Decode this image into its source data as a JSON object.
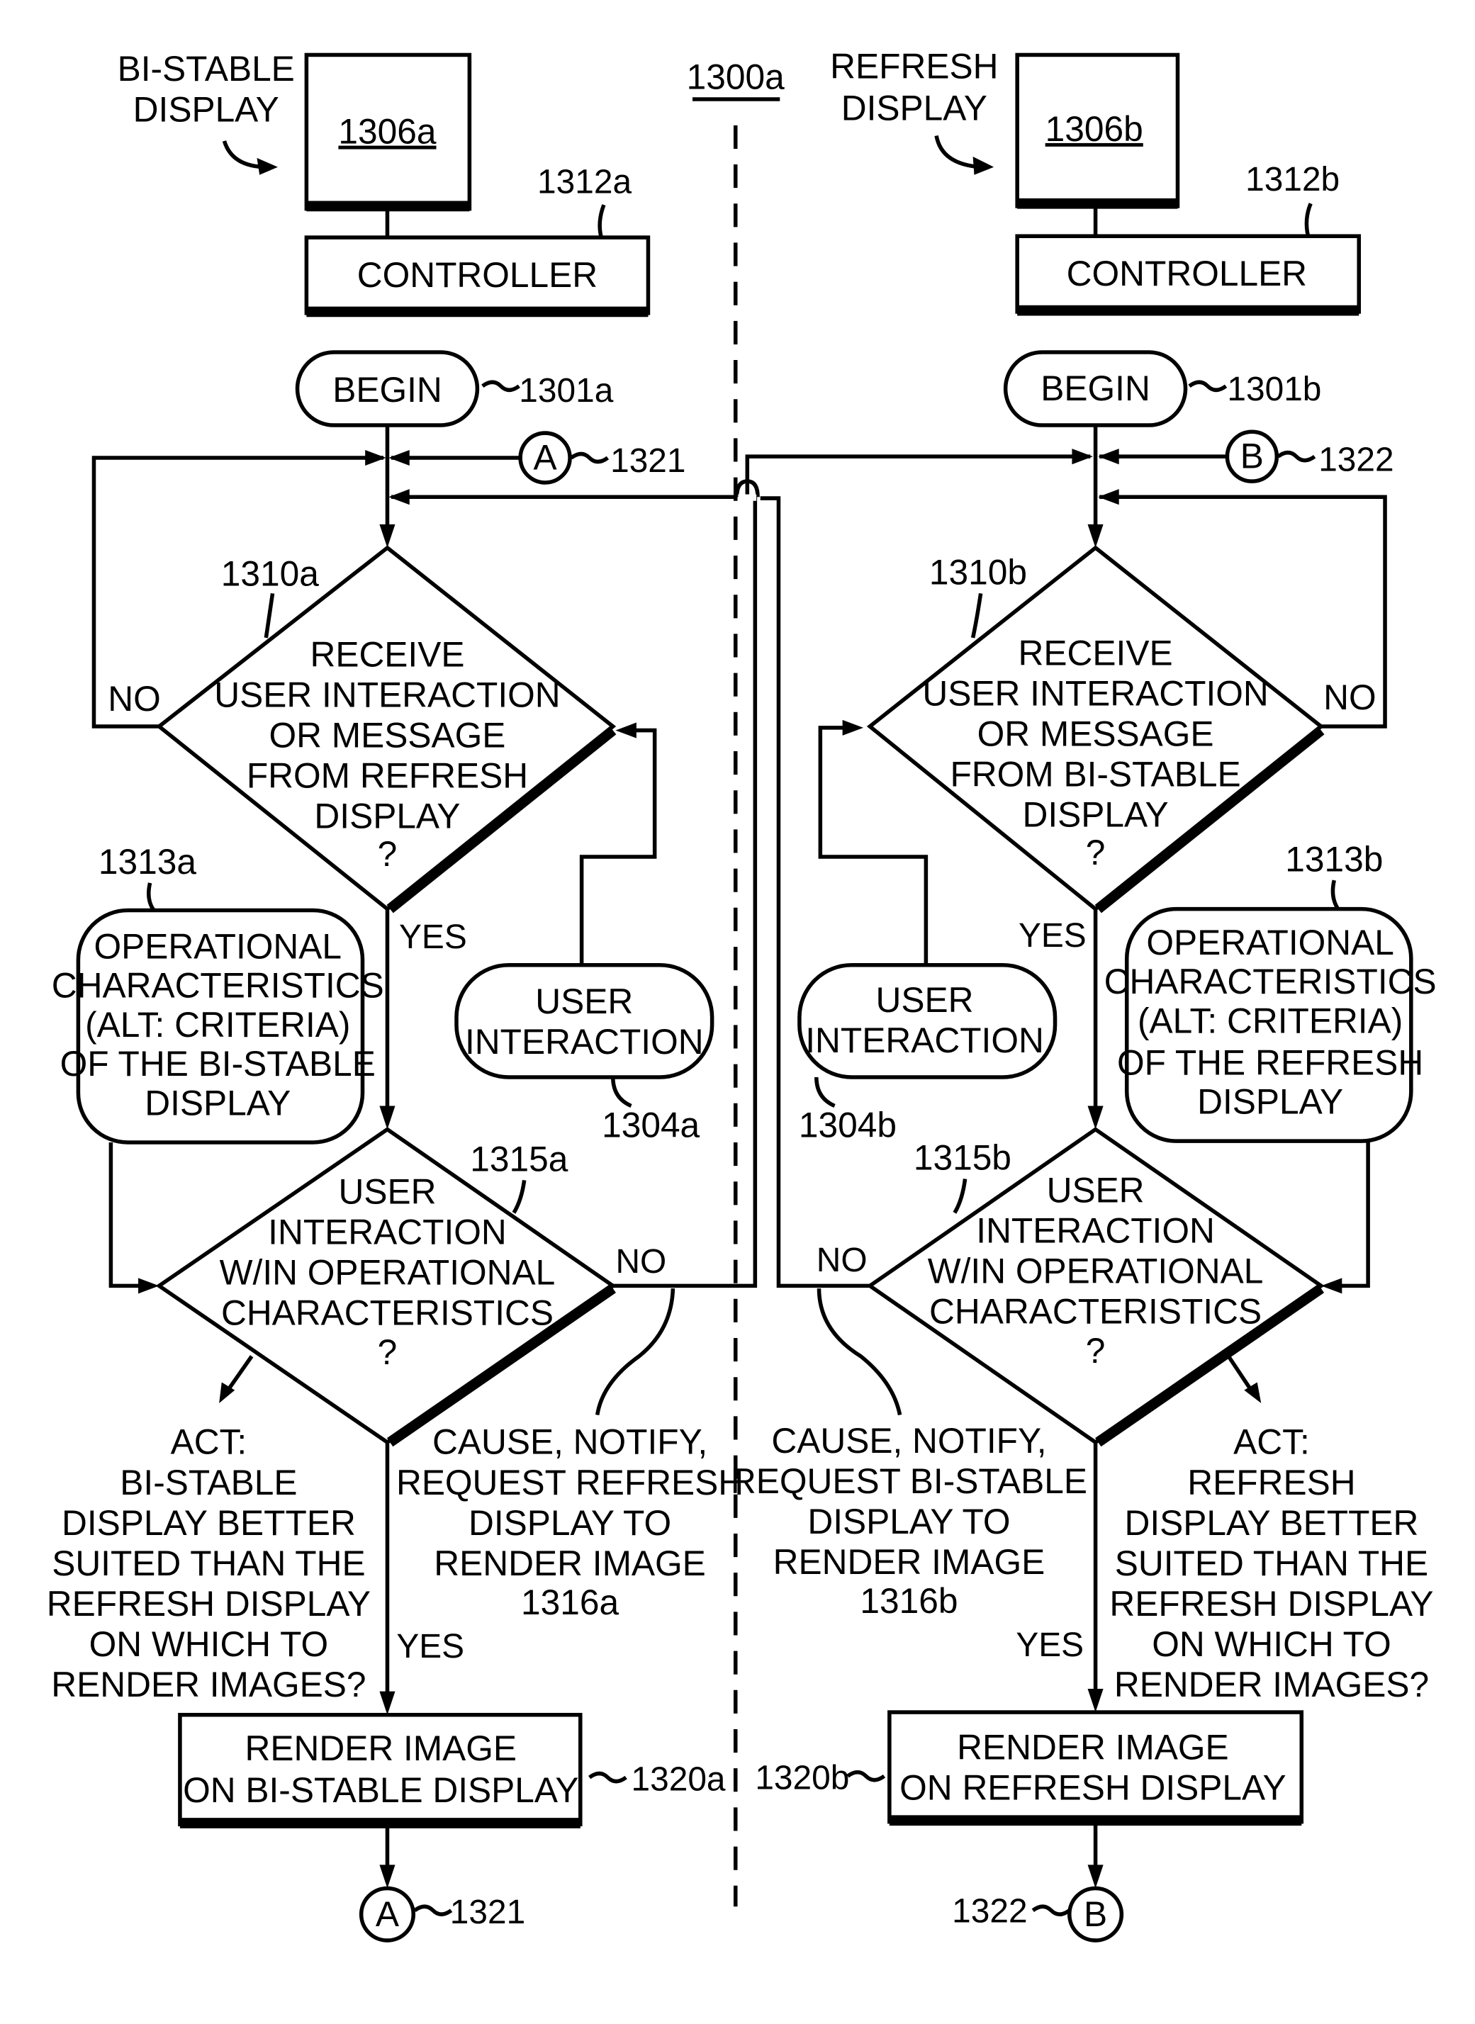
{
  "figure_label": "1300a",
  "left": {
    "display_caption": [
      "BI-STABLE",
      "DISPLAY"
    ],
    "display_ref": "1306a",
    "controller_label": "CONTROLLER",
    "controller_ref": "1312a",
    "begin_label": "BEGIN",
    "begin_ref": "1301a",
    "connector_label": "A",
    "connector_ref": "1321",
    "decision1_ref": "1310a",
    "decision1_lines": [
      "RECEIVE",
      "USER INTERACTION",
      "OR MESSAGE",
      "FROM REFRESH",
      "DISPLAY",
      "?"
    ],
    "no_label": "NO",
    "yes_label": "YES",
    "op_ref": "1313a",
    "op_lines": [
      "OPERATIONAL",
      "CHARACTERISTICS",
      "(ALT: CRITERIA)",
      "OF THE BI-STABLE",
      "DISPLAY"
    ],
    "user_interaction_lines": [
      "USER",
      "INTERACTION"
    ],
    "user_interaction_ref": "1304a",
    "decision2_ref": "1315a",
    "decision2_lines": [
      "USER",
      "INTERACTION",
      "W/IN OPERATIONAL",
      "CHARACTERISTICS",
      "?"
    ],
    "decision2_no": "NO",
    "decision2_yes": "YES",
    "act_lines": [
      "ACT:",
      "BI-STABLE",
      "DISPLAY BETTER",
      "SUITED THAN THE",
      "REFRESH DISPLAY",
      "ON WHICH TO",
      "RENDER IMAGES?"
    ],
    "cause_lines": [
      "CAUSE, NOTIFY,",
      "REQUEST REFRESH",
      "DISPLAY TO",
      "RENDER IMAGE",
      "1316a"
    ],
    "render_lines": [
      "RENDER IMAGE",
      "ON BI-STABLE DISPLAY"
    ],
    "render_ref": "1320a",
    "end_connector_label": "A",
    "end_connector_ref": "1321"
  },
  "right": {
    "display_caption": [
      "REFRESH",
      "DISPLAY"
    ],
    "display_ref": "1306b",
    "controller_label": "CONTROLLER",
    "controller_ref": "1312b",
    "begin_label": "BEGIN",
    "begin_ref": "1301b",
    "connector_label": "B",
    "connector_ref": "1322",
    "decision1_ref": "1310b",
    "decision1_lines": [
      "RECEIVE",
      "USER INTERACTION",
      "OR MESSAGE",
      "FROM BI-STABLE",
      "DISPLAY",
      "?"
    ],
    "no_label": "NO",
    "yes_label": "YES",
    "op_ref": "1313b",
    "op_lines": [
      "OPERATIONAL",
      "CHARACTERISTICS",
      "(ALT: CRITERIA)",
      "OF THE REFRESH",
      "DISPLAY"
    ],
    "user_interaction_lines": [
      "USER",
      "INTERACTION"
    ],
    "user_interaction_ref": "1304b",
    "decision2_ref": "1315b",
    "decision2_lines": [
      "USER",
      "INTERACTION",
      "W/IN OPERATIONAL",
      "CHARACTERISTICS",
      "?"
    ],
    "decision2_no": "NO",
    "decision2_yes": "YES",
    "act_lines": [
      "ACT:",
      "REFRESH",
      "DISPLAY BETTER",
      "SUITED THAN THE",
      "REFRESH DISPLAY",
      "ON WHICH TO",
      "RENDER IMAGES?"
    ],
    "cause_lines": [
      "CAUSE, NOTIFY,",
      "REQUEST BI-STABLE",
      "DISPLAY TO",
      "RENDER IMAGE",
      "1316b"
    ],
    "render_lines": [
      "RENDER IMAGE",
      "ON REFRESH DISPLAY"
    ],
    "render_ref": "1320b",
    "end_connector_label": "B",
    "end_connector_ref": "1322"
  }
}
